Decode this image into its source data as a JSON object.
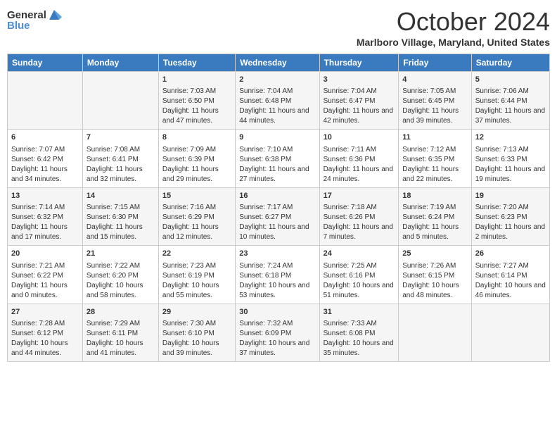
{
  "logo": {
    "general": "General",
    "blue": "Blue"
  },
  "title": "October 2024",
  "location": "Marlboro Village, Maryland, United States",
  "days_of_week": [
    "Sunday",
    "Monday",
    "Tuesday",
    "Wednesday",
    "Thursday",
    "Friday",
    "Saturday"
  ],
  "weeks": [
    [
      {
        "day": "",
        "sunrise": "",
        "sunset": "",
        "daylight": ""
      },
      {
        "day": "",
        "sunrise": "",
        "sunset": "",
        "daylight": ""
      },
      {
        "day": "1",
        "sunrise": "Sunrise: 7:03 AM",
        "sunset": "Sunset: 6:50 PM",
        "daylight": "Daylight: 11 hours and 47 minutes."
      },
      {
        "day": "2",
        "sunrise": "Sunrise: 7:04 AM",
        "sunset": "Sunset: 6:48 PM",
        "daylight": "Daylight: 11 hours and 44 minutes."
      },
      {
        "day": "3",
        "sunrise": "Sunrise: 7:04 AM",
        "sunset": "Sunset: 6:47 PM",
        "daylight": "Daylight: 11 hours and 42 minutes."
      },
      {
        "day": "4",
        "sunrise": "Sunrise: 7:05 AM",
        "sunset": "Sunset: 6:45 PM",
        "daylight": "Daylight: 11 hours and 39 minutes."
      },
      {
        "day": "5",
        "sunrise": "Sunrise: 7:06 AM",
        "sunset": "Sunset: 6:44 PM",
        "daylight": "Daylight: 11 hours and 37 minutes."
      }
    ],
    [
      {
        "day": "6",
        "sunrise": "Sunrise: 7:07 AM",
        "sunset": "Sunset: 6:42 PM",
        "daylight": "Daylight: 11 hours and 34 minutes."
      },
      {
        "day": "7",
        "sunrise": "Sunrise: 7:08 AM",
        "sunset": "Sunset: 6:41 PM",
        "daylight": "Daylight: 11 hours and 32 minutes."
      },
      {
        "day": "8",
        "sunrise": "Sunrise: 7:09 AM",
        "sunset": "Sunset: 6:39 PM",
        "daylight": "Daylight: 11 hours and 29 minutes."
      },
      {
        "day": "9",
        "sunrise": "Sunrise: 7:10 AM",
        "sunset": "Sunset: 6:38 PM",
        "daylight": "Daylight: 11 hours and 27 minutes."
      },
      {
        "day": "10",
        "sunrise": "Sunrise: 7:11 AM",
        "sunset": "Sunset: 6:36 PM",
        "daylight": "Daylight: 11 hours and 24 minutes."
      },
      {
        "day": "11",
        "sunrise": "Sunrise: 7:12 AM",
        "sunset": "Sunset: 6:35 PM",
        "daylight": "Daylight: 11 hours and 22 minutes."
      },
      {
        "day": "12",
        "sunrise": "Sunrise: 7:13 AM",
        "sunset": "Sunset: 6:33 PM",
        "daylight": "Daylight: 11 hours and 19 minutes."
      }
    ],
    [
      {
        "day": "13",
        "sunrise": "Sunrise: 7:14 AM",
        "sunset": "Sunset: 6:32 PM",
        "daylight": "Daylight: 11 hours and 17 minutes."
      },
      {
        "day": "14",
        "sunrise": "Sunrise: 7:15 AM",
        "sunset": "Sunset: 6:30 PM",
        "daylight": "Daylight: 11 hours and 15 minutes."
      },
      {
        "day": "15",
        "sunrise": "Sunrise: 7:16 AM",
        "sunset": "Sunset: 6:29 PM",
        "daylight": "Daylight: 11 hours and 12 minutes."
      },
      {
        "day": "16",
        "sunrise": "Sunrise: 7:17 AM",
        "sunset": "Sunset: 6:27 PM",
        "daylight": "Daylight: 11 hours and 10 minutes."
      },
      {
        "day": "17",
        "sunrise": "Sunrise: 7:18 AM",
        "sunset": "Sunset: 6:26 PM",
        "daylight": "Daylight: 11 hours and 7 minutes."
      },
      {
        "day": "18",
        "sunrise": "Sunrise: 7:19 AM",
        "sunset": "Sunset: 6:24 PM",
        "daylight": "Daylight: 11 hours and 5 minutes."
      },
      {
        "day": "19",
        "sunrise": "Sunrise: 7:20 AM",
        "sunset": "Sunset: 6:23 PM",
        "daylight": "Daylight: 11 hours and 2 minutes."
      }
    ],
    [
      {
        "day": "20",
        "sunrise": "Sunrise: 7:21 AM",
        "sunset": "Sunset: 6:22 PM",
        "daylight": "Daylight: 11 hours and 0 minutes."
      },
      {
        "day": "21",
        "sunrise": "Sunrise: 7:22 AM",
        "sunset": "Sunset: 6:20 PM",
        "daylight": "Daylight: 10 hours and 58 minutes."
      },
      {
        "day": "22",
        "sunrise": "Sunrise: 7:23 AM",
        "sunset": "Sunset: 6:19 PM",
        "daylight": "Daylight: 10 hours and 55 minutes."
      },
      {
        "day": "23",
        "sunrise": "Sunrise: 7:24 AM",
        "sunset": "Sunset: 6:18 PM",
        "daylight": "Daylight: 10 hours and 53 minutes."
      },
      {
        "day": "24",
        "sunrise": "Sunrise: 7:25 AM",
        "sunset": "Sunset: 6:16 PM",
        "daylight": "Daylight: 10 hours and 51 minutes."
      },
      {
        "day": "25",
        "sunrise": "Sunrise: 7:26 AM",
        "sunset": "Sunset: 6:15 PM",
        "daylight": "Daylight: 10 hours and 48 minutes."
      },
      {
        "day": "26",
        "sunrise": "Sunrise: 7:27 AM",
        "sunset": "Sunset: 6:14 PM",
        "daylight": "Daylight: 10 hours and 46 minutes."
      }
    ],
    [
      {
        "day": "27",
        "sunrise": "Sunrise: 7:28 AM",
        "sunset": "Sunset: 6:12 PM",
        "daylight": "Daylight: 10 hours and 44 minutes."
      },
      {
        "day": "28",
        "sunrise": "Sunrise: 7:29 AM",
        "sunset": "Sunset: 6:11 PM",
        "daylight": "Daylight: 10 hours and 41 minutes."
      },
      {
        "day": "29",
        "sunrise": "Sunrise: 7:30 AM",
        "sunset": "Sunset: 6:10 PM",
        "daylight": "Daylight: 10 hours and 39 minutes."
      },
      {
        "day": "30",
        "sunrise": "Sunrise: 7:32 AM",
        "sunset": "Sunset: 6:09 PM",
        "daylight": "Daylight: 10 hours and 37 minutes."
      },
      {
        "day": "31",
        "sunrise": "Sunrise: 7:33 AM",
        "sunset": "Sunset: 6:08 PM",
        "daylight": "Daylight: 10 hours and 35 minutes."
      },
      {
        "day": "",
        "sunrise": "",
        "sunset": "",
        "daylight": ""
      },
      {
        "day": "",
        "sunrise": "",
        "sunset": "",
        "daylight": ""
      }
    ]
  ]
}
